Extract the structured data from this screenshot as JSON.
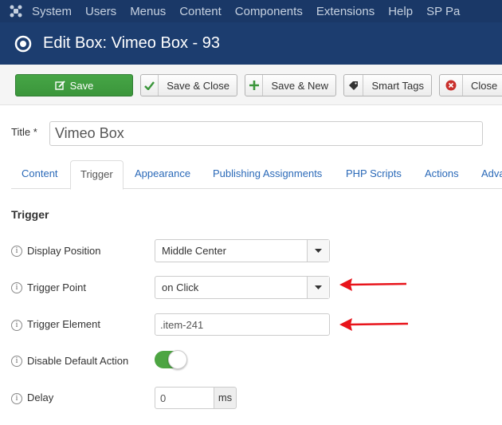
{
  "topbar": {
    "menu": [
      "System",
      "Users",
      "Menus",
      "Content",
      "Components",
      "Extensions",
      "Help",
      "SP Pa"
    ]
  },
  "header": {
    "title": "Edit Box: Vimeo Box - 93"
  },
  "toolbar": {
    "save": "Save",
    "save_close": "Save & Close",
    "save_new": "Save & New",
    "smart_tags": "Smart Tags",
    "close": "Close"
  },
  "form": {
    "title_label": "Title *",
    "title_value": "Vimeo Box"
  },
  "tabs": [
    "Content",
    "Trigger",
    "Appearance",
    "Publishing Assignments",
    "PHP Scripts",
    "Actions",
    "Adva"
  ],
  "active_tab": "Trigger",
  "section": {
    "title": "Trigger",
    "fields": {
      "display_position": {
        "label": "Display Position",
        "value": "Middle Center"
      },
      "trigger_point": {
        "label": "Trigger Point",
        "value": "on Click"
      },
      "trigger_element": {
        "label": "Trigger Element",
        "value": ".item-241"
      },
      "disable_default": {
        "label": "Disable Default Action",
        "enabled": true
      },
      "delay": {
        "label": "Delay",
        "value": "0",
        "unit": "ms"
      }
    }
  },
  "colors": {
    "topbar": "#1a3867",
    "titlebar": "#1c3d6f",
    "save_green": "#46a546",
    "link": "#2a69b8",
    "annotation_arrow": "#e8141b"
  },
  "icons": {
    "logo": "joomla-logo-icon",
    "title": "target-circle-icon",
    "save": "edit-icon",
    "save_close": "check-icon",
    "save_new": "plus-icon",
    "smart_tags": "tag-icon",
    "close": "close-circle-icon",
    "info": "info-icon",
    "caret": "caret-down-icon"
  }
}
